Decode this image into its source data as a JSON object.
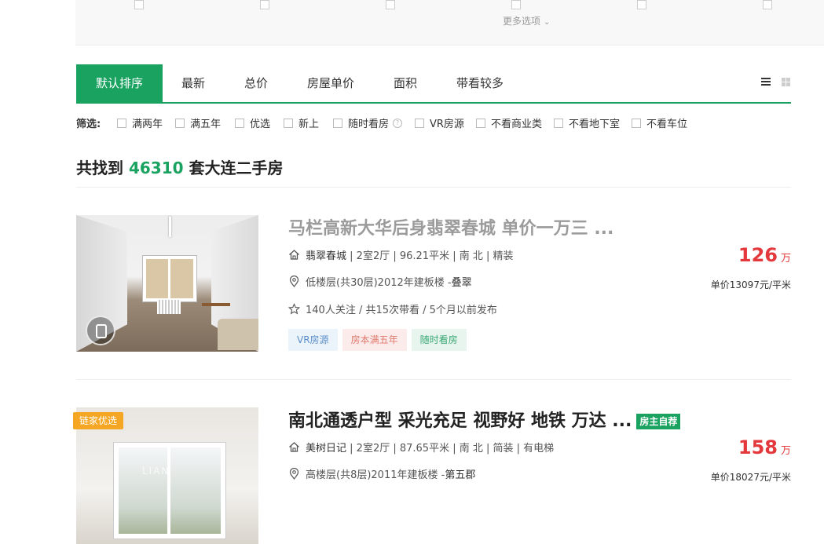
{
  "top_panel": {
    "more_options": "更多选项"
  },
  "sort_tabs": [
    {
      "label": "默认排序",
      "active": true
    },
    {
      "label": "最新"
    },
    {
      "label": "总价"
    },
    {
      "label": "房屋单价"
    },
    {
      "label": "面积"
    },
    {
      "label": "带看较多"
    }
  ],
  "filters": {
    "label": "筛选:",
    "items": [
      "满两年",
      "满五年",
      "优选",
      "新上",
      "随时看房",
      "VR房源",
      "不看商业类",
      "不看地下室",
      "不看车位"
    ]
  },
  "result": {
    "prefix": "共找到",
    "count": "46310",
    "suffix": "套大连二手房"
  },
  "listings": [
    {
      "title": "马栏高新大华后身翡翠春城 单价一万三 ...",
      "community": "翡翠春城",
      "details": "| 2室2厅 | 96.21平米 | 南 北 | 精装",
      "floor": "低楼层(共30层)2012年建板楼 - ",
      "area": "叠翠",
      "follow": "140人关注 / 共15次带看 / 5个月以前发布",
      "tags": [
        "VR房源",
        "房本满五年",
        "随时看房"
      ],
      "total_price": "126",
      "price_unit": "万",
      "unit_price": "单价13097元/平米"
    },
    {
      "badge": "链家优选",
      "title": "南北通透户型 采光充足 视野好 地铁 万达 ...",
      "owner_tag": "房主自荐",
      "community": "美树日记",
      "details": "| 2室2厅 | 87.65平米 | 南 北 | 简装 | 有电梯",
      "floor": "高楼层(共8层)2011年建板楼 - ",
      "area": "第五郡",
      "watermark": "LIAN",
      "total_price": "158",
      "price_unit": "万",
      "unit_price": "单价18027元/平米"
    }
  ],
  "colors": {
    "brand_green": "#1aa260",
    "price_red": "#e4393c"
  },
  "icons": [
    "house-icon",
    "location-icon",
    "star-icon",
    "list-view-icon",
    "grid-view-icon",
    "help-icon",
    "chevron-down-icon",
    "vr-icon"
  ]
}
